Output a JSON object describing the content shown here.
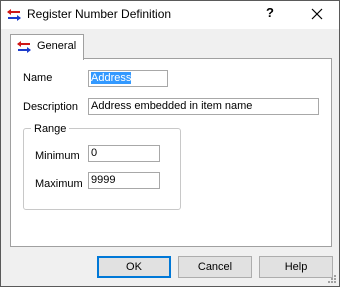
{
  "window": {
    "title": "Register Number Definition",
    "icon": "register-arrows-icon",
    "help_glyph": "?",
    "close_icon": "close-icon"
  },
  "tabs": [
    {
      "label": "General",
      "icon": "register-arrows-icon",
      "active": true
    }
  ],
  "form": {
    "name_label": "Name",
    "name_value": "Address",
    "description_label": "Description",
    "description_value": "Address embedded in item name",
    "range": {
      "title": "Range",
      "minimum_label": "Minimum",
      "minimum_value": "0",
      "maximum_label": "Maximum",
      "maximum_value": "9999"
    }
  },
  "buttons": {
    "ok": "OK",
    "cancel": "Cancel",
    "help": "Help"
  },
  "colors": {
    "selection": "#3399ff",
    "default_button_border": "#0078d7",
    "icon_red": "#d01818",
    "icon_blue": "#1c3ccc"
  }
}
